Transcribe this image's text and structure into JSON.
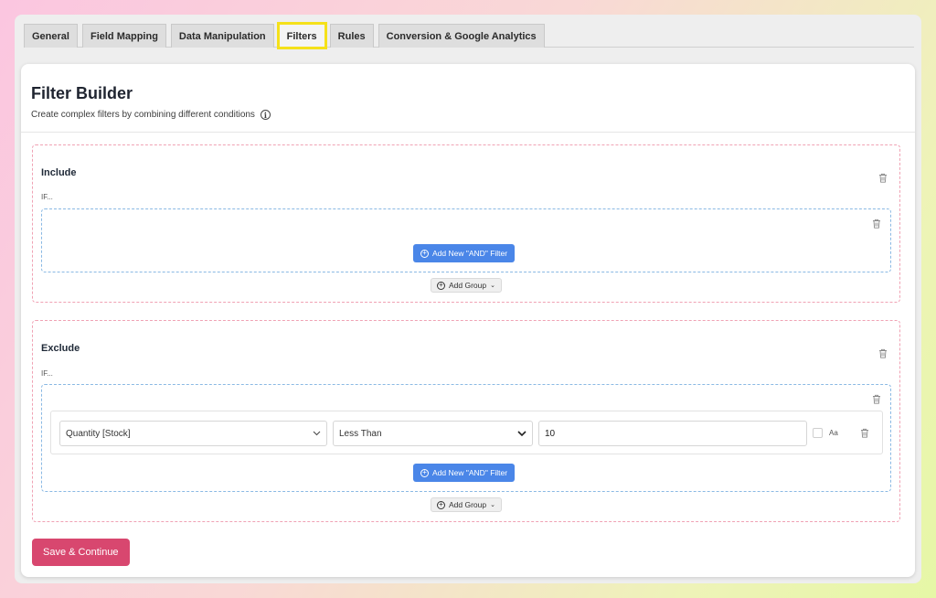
{
  "tabs": [
    {
      "label": "General"
    },
    {
      "label": "Field Mapping"
    },
    {
      "label": "Data Manipulation"
    },
    {
      "label": "Filters"
    },
    {
      "label": "Rules"
    },
    {
      "label": "Conversion & Google Analytics"
    }
  ],
  "active_tab": "Filters",
  "header": {
    "title": "Filter Builder",
    "subtitle": "Create complex filters by combining different conditions",
    "info_icon": "i"
  },
  "include": {
    "title": "Include",
    "if_label": "IF...",
    "add_and_label": "Add New \"AND\" Filter",
    "add_group_label": "Add Group"
  },
  "exclude": {
    "title": "Exclude",
    "if_label": "IF...",
    "filter": {
      "field": "Quantity [Stock]",
      "operator": "Less Than",
      "value": "10",
      "case_label": "Aa",
      "case_sensitive": false
    },
    "add_and_label": "Add New \"AND\" Filter",
    "add_group_label": "Add Group"
  },
  "save_label": "Save & Continue",
  "colors": {
    "accent_blue": "#4a86e8",
    "save_pink": "#d8476f",
    "highlight_yellow": "#f5e11a",
    "include_border": "#f0a2b4",
    "group_border": "#8ab9e4"
  }
}
